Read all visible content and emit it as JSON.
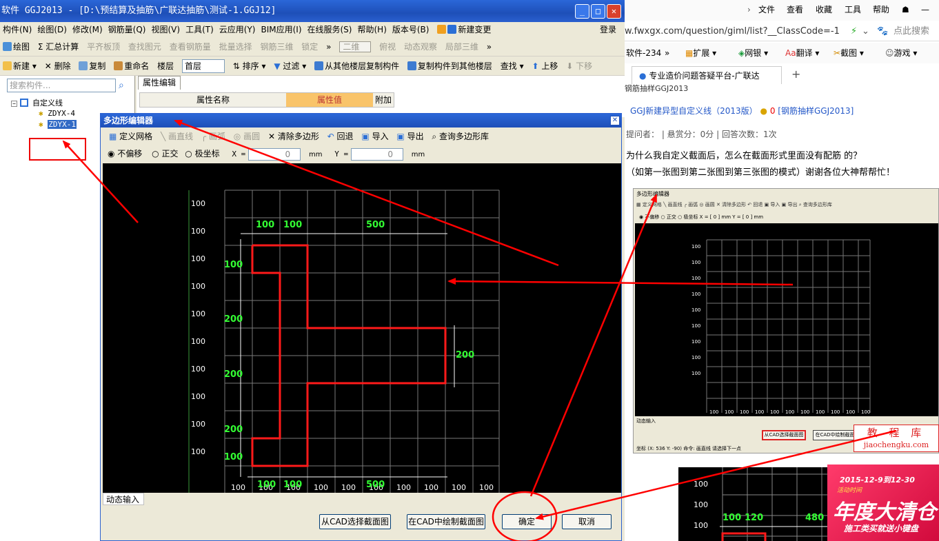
{
  "app": {
    "title": "软件 GGJ2013 - [D:\\预结算及抽筋\\广联达抽筋\\测试-1.GGJ12]",
    "menu": [
      "构件(N)",
      "绘图(D)",
      "修改(M)",
      "钢筋量(Q)",
      "视图(V)",
      "工具(T)",
      "云应用(Y)",
      "BIM应用(I)",
      "在线服务(S)",
      "帮助(H)",
      "版本号(B)"
    ],
    "menu_new_change": "新建变更",
    "login": "登录",
    "toolbar1": [
      "绘图",
      "Σ 汇总计算",
      "平齐板顶",
      "查找图元",
      "查看钢筋量",
      "批量选择",
      "钢筋三维",
      "锁定",
      "»",
      "二维",
      "俯视",
      "动态观察",
      "局部三维",
      "»"
    ],
    "toolbar2": {
      "new": "新建",
      "delete": "删除",
      "copy": "复制",
      "rename": "重命名",
      "floor_label": "楼层",
      "floor_value": "首层",
      "sort": "排序",
      "filter": "过滤",
      "copy_from": "从其他楼层复制构件",
      "copy_to": "复制构件到其他楼层",
      "find": "查找",
      "up": "上移",
      "down": "下移"
    },
    "search_placeholder": "搜索构件...",
    "tree": {
      "root": "自定义线",
      "items": [
        "ZDYX-4",
        "ZDYX-1"
      ]
    },
    "prop_tab": "属性编辑",
    "prop_headers": [
      "属性名称",
      "属性值",
      "附加"
    ]
  },
  "dialog": {
    "title": "多边形编辑器",
    "tools": [
      "定义网格",
      "画直线",
      "画弧",
      "画圆",
      "清除多边形",
      "回退",
      "导入",
      "导出",
      "查询多边形库"
    ],
    "options": {
      "no_offset": "不偏移",
      "ortho": "正交",
      "polar": "极坐标",
      "x_label": "X =",
      "x_value": "0",
      "y_label": "Y =",
      "y_value": "0",
      "unit": "mm"
    },
    "grid_left": [
      "100",
      "100",
      "100",
      "100",
      "100",
      "100",
      "100",
      "100",
      "100",
      "100"
    ],
    "grid_bottom": [
      "100",
      "100",
      "100",
      "100",
      "100",
      "100",
      "100",
      "100",
      "100",
      "100"
    ],
    "dim_top": [
      "100",
      "100",
      "500"
    ],
    "dim_left": [
      "100",
      "200",
      "200",
      "200",
      "100"
    ],
    "dim_right": "200",
    "dim_bottom": [
      "100",
      "100",
      "500"
    ],
    "dynamic_input": "动态输入",
    "btn_cad_select": "从CAD选择截面图",
    "btn_cad_draw": "在CAD中绘制截面图",
    "btn_ok": "确定",
    "btn_cancel": "取消"
  },
  "browser": {
    "menu": [
      "文件",
      "查看",
      "收藏",
      "工具",
      "帮助"
    ],
    "url": "w.fwxgx.com/question/giml/list?__ClassCode=-1",
    "search_hint": "点此搜索",
    "fav": "软件-234",
    "fav_items": [
      "扩展",
      "网银",
      "翻译",
      "截图",
      "游戏"
    ],
    "tab_title": "专业造价问题答疑平台-广联达",
    "crumb": "钢筋抽样GGJ2013",
    "q_title": "GGJ新建异型自定义线（2013版）",
    "q_score": "0",
    "q_meta": "提问者：  |  悬赏分：0分  |  回答次数：1次",
    "q_body1": "为什么我自定义截面后，怎么在截面形式里面没有配筋 的？",
    "q_body2": "（如第一张图到第二张图到第三张图的模式）谢谢各位大神帮帮忙！",
    "thumb_title": "多边形编辑器",
    "thumb_status": "坐标 (X: 536 Y: -90)   命令: 画直线   请选择下一点",
    "watermark1": "教 程 库",
    "watermark2": "jiaochengku.com",
    "ad1": "2015-12-9到12-30",
    "ad2": "年度大清仓",
    "ad3": "施工类买就送小键盘",
    "thumb2_dims": [
      "100",
      "120",
      "480"
    ]
  },
  "colors": {
    "accent_red": "#ff0000",
    "dim_green": "#33ff33",
    "title_blue": "#2458c8"
  }
}
